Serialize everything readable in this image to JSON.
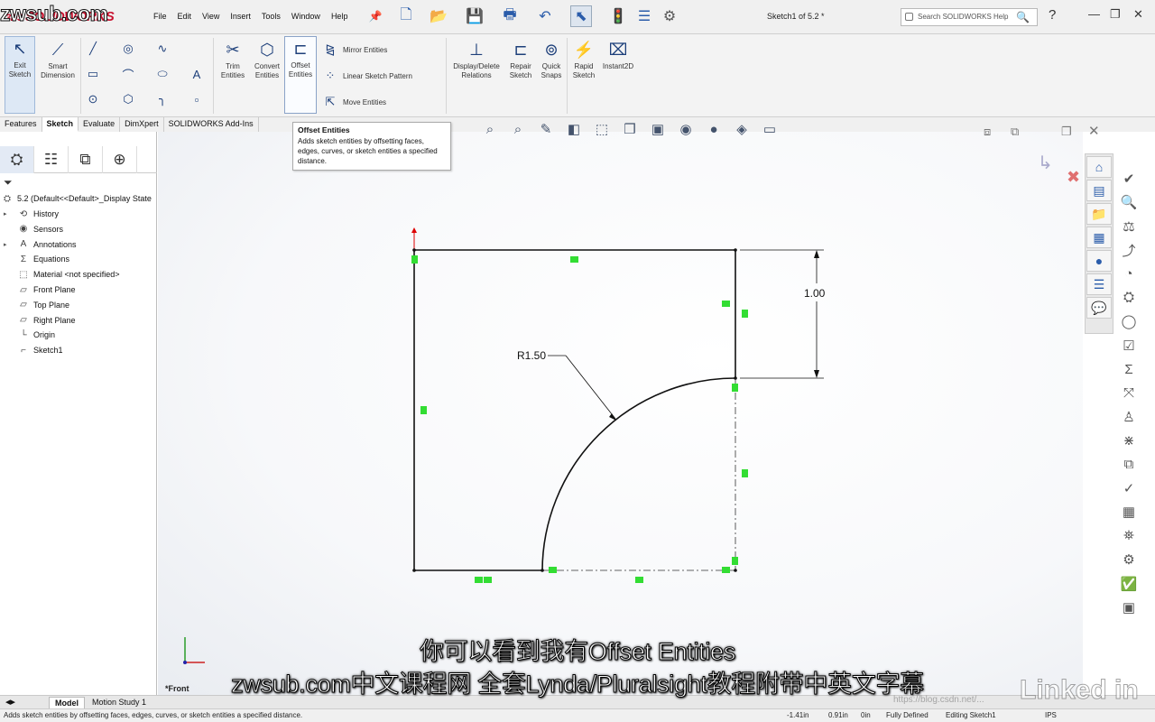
{
  "watermark": "zwsub.com",
  "app": {
    "brand": "SOLIDWORKS",
    "brand_prefix": "3DS",
    "document_title": "Sketch1 of 5.2 *",
    "search_placeholder": "Search SOLIDWORKS Help"
  },
  "menu": [
    "File",
    "Edit",
    "View",
    "Insert",
    "Tools",
    "Window",
    "Help"
  ],
  "ribbon": {
    "exit_sketch": "Exit\nSketch",
    "smart_dimension": "Smart\nDimension",
    "trim_entities": "Trim\nEntities",
    "convert_entities": "Convert\nEntities",
    "offset_entities": "Offset\nEntities",
    "mirror_entities": "Mirror Entities",
    "linear_pattern": "Linear Sketch Pattern",
    "move_entities": "Move Entities",
    "display_relations": "Display/Delete\nRelations",
    "repair_sketch": "Repair\nSketch",
    "quick_snaps": "Quick\nSnaps",
    "rapid_sketch": "Rapid\nSketch",
    "instant2d": "Instant2D"
  },
  "command_tabs": [
    "Features",
    "Sketch",
    "Evaluate",
    "DimXpert",
    "SOLIDWORKS Add-Ins"
  ],
  "active_command_tab": "Sketch",
  "tooltip": {
    "title": "Offset Entities",
    "body": "Adds sketch entities by offsetting faces, edges, curves, or sketch entities a specified distance."
  },
  "tree": {
    "root": "5.2  (Default<<Default>_Display State",
    "items": [
      {
        "label": "History",
        "icon": "history-icon",
        "expandable": true
      },
      {
        "label": "Sensors",
        "icon": "sensors-icon",
        "expandable": false
      },
      {
        "label": "Annotations",
        "icon": "annotations-icon",
        "expandable": true
      },
      {
        "label": "Equations",
        "icon": "equations-icon",
        "expandable": false
      },
      {
        "label": "Material <not specified>",
        "icon": "material-icon",
        "expandable": false
      },
      {
        "label": "Front Plane",
        "icon": "plane-icon",
        "expandable": false
      },
      {
        "label": "Top Plane",
        "icon": "plane-icon",
        "expandable": false
      },
      {
        "label": "Right Plane",
        "icon": "plane-icon",
        "expandable": false
      },
      {
        "label": "Origin",
        "icon": "origin-icon",
        "expandable": false
      },
      {
        "label": "Sketch1",
        "icon": "sketch-icon",
        "expandable": false
      }
    ]
  },
  "sketch": {
    "radius_label": "R1.50",
    "dimension_label": "1.00",
    "view_label": "*Front"
  },
  "bottom_tabs": [
    "Model",
    "Motion Study 1"
  ],
  "status": {
    "message": "Adds sketch entities by offsetting faces, edges, curves, or sketch entities a specified distance.",
    "x": "-1.41in",
    "y": "0.91in",
    "z": "0in",
    "definition": "Fully Defined",
    "editing": "Editing Sketch1",
    "units": "IPS"
  },
  "subtitles": {
    "line1": "你可以看到我有Offset Entities",
    "line2": "zwsub.com中文课程网 全套Lynda/Pluralsight教程附带中英文字幕"
  },
  "linkedin_watermark": "Linked in",
  "csdn_watermark": "https://blog.csdn.net/..."
}
